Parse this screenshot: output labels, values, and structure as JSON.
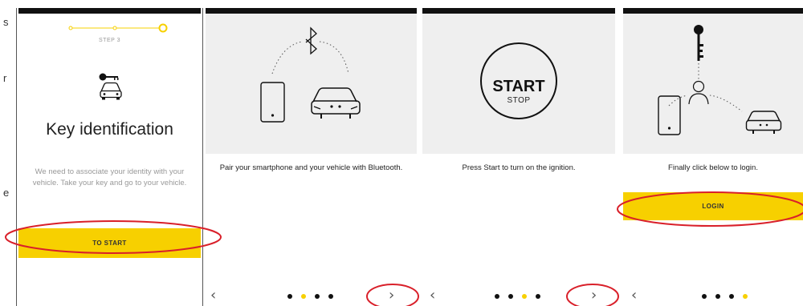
{
  "colors": {
    "accent": "#f7d000",
    "annotation": "#d9202a",
    "illustration_bg": "#efefef"
  },
  "edge_chars": [
    "s",
    "r",
    "e"
  ],
  "screen1": {
    "step_label": "STEP 3",
    "icon": "key-icon",
    "car_icon": "car-front-icon",
    "title": "Key identification",
    "description": "We need to associate your identity with your vehicle. Take your key and go to your vehicle.",
    "button": "TO START"
  },
  "screen2": {
    "icons": [
      "bluetooth-icon",
      "smartphone-icon",
      "car-front-icon"
    ],
    "text": "Pair your smartphone and your vehicle with Bluetooth.",
    "pagination_active": 1,
    "prev": "‹",
    "next": "›"
  },
  "screen3": {
    "start_label": "START",
    "stop_label": "STOP",
    "text": "Press Start to turn on the ignition.",
    "pagination_active": 2,
    "prev": "‹",
    "next": "›"
  },
  "screen4": {
    "icons": [
      "key-icon",
      "person-icon",
      "smartphone-icon",
      "car-front-icon"
    ],
    "text": "Finally click below to login.",
    "button": "LOGIN",
    "pagination_active": 3,
    "prev": "‹"
  }
}
